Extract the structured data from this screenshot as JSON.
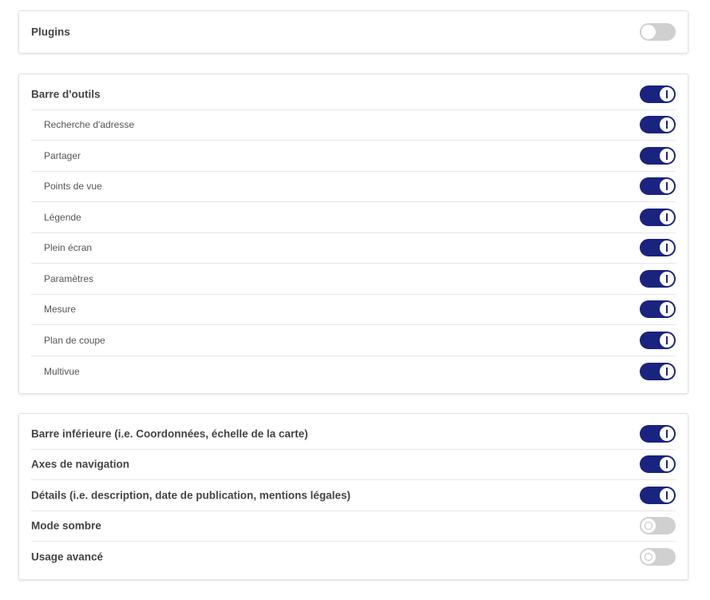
{
  "plugins": {
    "label": "Plugins",
    "enabled": false
  },
  "toolbar": {
    "label": "Barre d'outils",
    "enabled": true,
    "items": [
      {
        "label": "Recherche d'adresse",
        "enabled": true
      },
      {
        "label": "Partager",
        "enabled": true
      },
      {
        "label": "Points de vue",
        "enabled": true
      },
      {
        "label": "Légende",
        "enabled": true
      },
      {
        "label": "Plein écran",
        "enabled": true
      },
      {
        "label": "Paramètres",
        "enabled": true
      },
      {
        "label": "Mesure",
        "enabled": true
      },
      {
        "label": "Plan de coupe",
        "enabled": true
      },
      {
        "label": "Multivue",
        "enabled": true
      }
    ]
  },
  "other": {
    "items": [
      {
        "label": "Barre inférieure (i.e. Coordonnées, échelle de la carte)",
        "enabled": true
      },
      {
        "label": "Axes de navigation",
        "enabled": true
      },
      {
        "label": "Détails (i.e. description, date de publication, mentions légales)",
        "enabled": true
      },
      {
        "label": "Mode sombre",
        "enabled": false
      },
      {
        "label": "Usage avancé",
        "enabled": false
      }
    ]
  },
  "colors": {
    "toggle_on": "#1a237e",
    "toggle_off": "#d0d0d0"
  }
}
